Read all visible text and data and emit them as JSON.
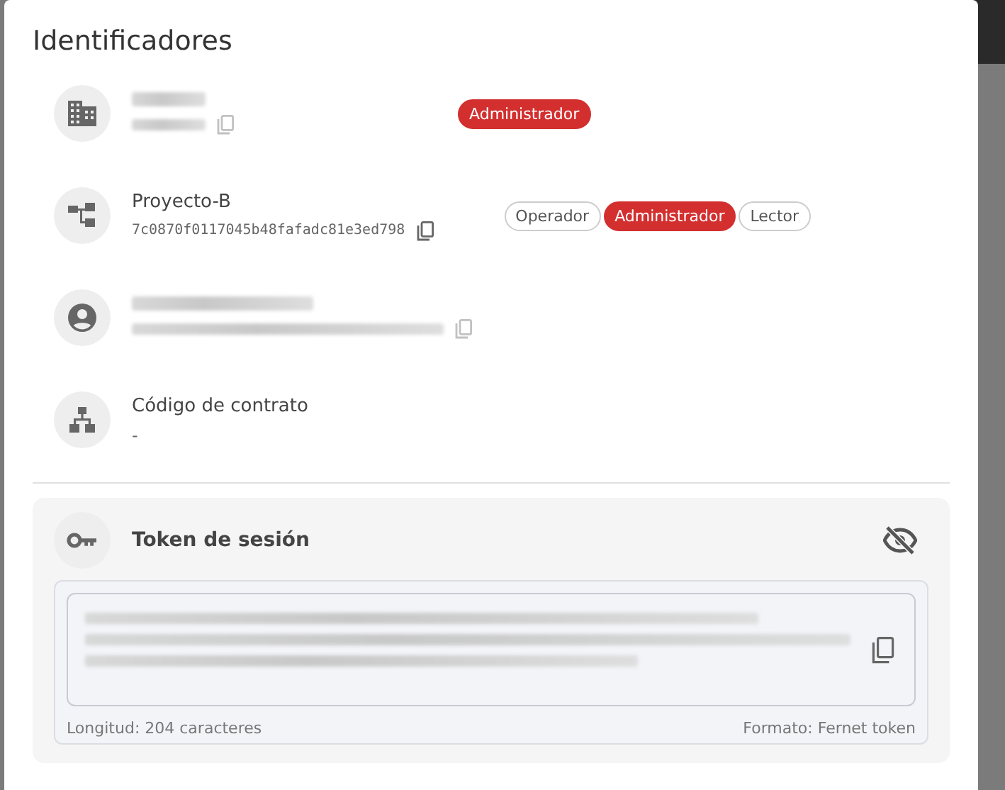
{
  "title": "Identificadores",
  "items": [
    {
      "kind": "organization",
      "name_blurred": true,
      "id_blurred": true,
      "copyable": true,
      "roles": [
        {
          "label": "Administrador",
          "selected": true
        }
      ]
    },
    {
      "kind": "project",
      "name": "Proyecto-B",
      "id": "7c0870f0117045b48fafadc81e3ed798",
      "copyable": true,
      "roles": [
        {
          "label": "Operador",
          "selected": false
        },
        {
          "label": "Administrador",
          "selected": true
        },
        {
          "label": "Lector",
          "selected": false
        }
      ]
    },
    {
      "kind": "user",
      "name_blurred": true,
      "id_blurred": true,
      "copyable": true
    },
    {
      "kind": "contract",
      "name": "Código de contrato",
      "id": "-",
      "copyable": false
    }
  ],
  "token": {
    "title": "Token de sesión",
    "visible": false,
    "value_blurred": true,
    "length_label": "Longitud: 204 caracteres",
    "format_label": "Formato: Fernet token"
  }
}
